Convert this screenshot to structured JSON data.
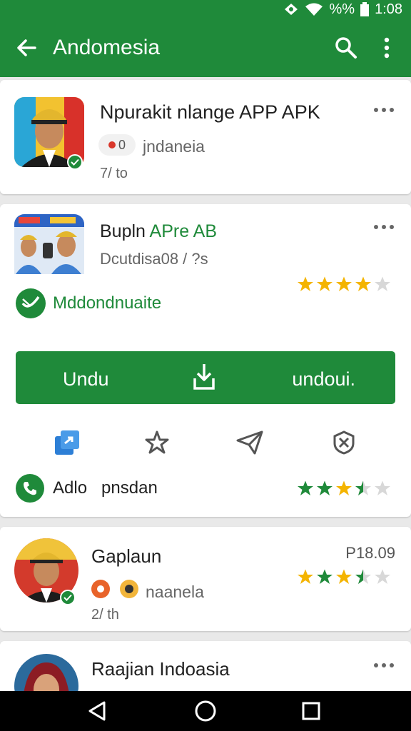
{
  "status_bar": {
    "battery": "%%",
    "time": "1:08"
  },
  "app_bar": {
    "title": "Andomesia"
  },
  "cards": [
    {
      "title": "Npurakit nlange APP APK",
      "chip_text": "0",
      "subtitle": "jndaneia",
      "meta": "7/ to"
    },
    {
      "title_black": "Bupln",
      "title_green": "APre AB",
      "subtitle": "Dcutdisa08 / ?s",
      "rating": 4,
      "verified_label": "Mddondnuaite",
      "download_left": "Undu",
      "download_right": "undoui.",
      "contact_label": "Adlo",
      "contact_value": "pnsdan",
      "contact_rating": 3.5
    },
    {
      "title": "Gaplaun",
      "price": "P18.09",
      "subtitle": "naanela",
      "meta": "2/ th",
      "rating": 3.5
    },
    {
      "title": "Raajian Indoasia"
    }
  ],
  "colors": {
    "primary": "#1f8a3a",
    "star": "#f4b400",
    "star_green": "#1f8a3a",
    "star_empty": "#d8d8d8"
  }
}
